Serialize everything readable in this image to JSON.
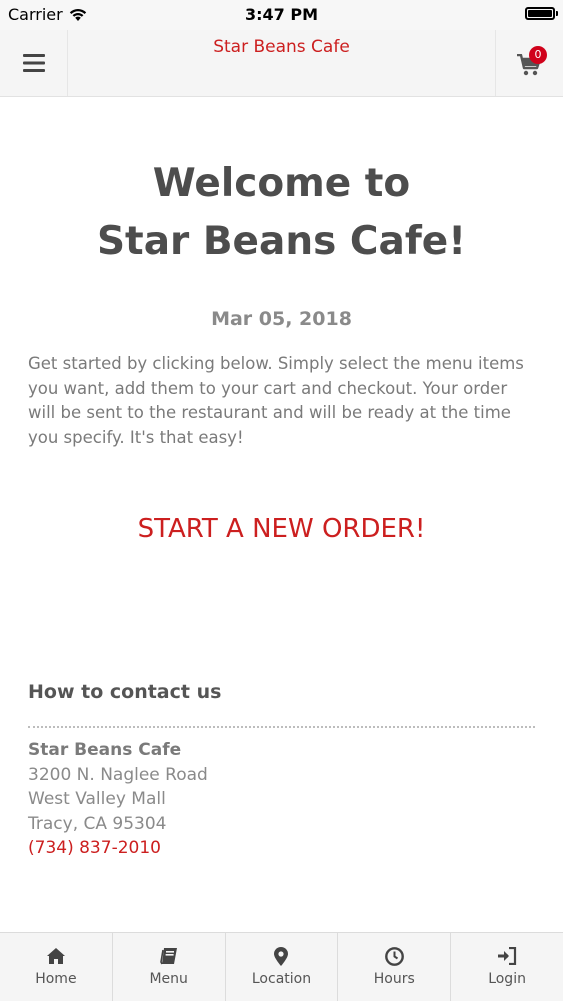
{
  "status_bar": {
    "carrier": "Carrier",
    "time": "3:47 PM"
  },
  "header": {
    "title": "Star Beans Cafe",
    "cart_count": "0"
  },
  "welcome": {
    "line1": "Welcome to",
    "line2": "Star Beans Cafe!"
  },
  "date": "Mar 05, 2018",
  "intro_text": "Get started by clicking below. Simply select the menu items you want, add them to your cart and checkout. Your order will be sent to the restaurant and will be ready at the time you specify. It's that easy!",
  "start_order_label": "START A NEW ORDER!",
  "contact": {
    "heading": "How to contact us",
    "name": "Star Beans Cafe",
    "address1": "3200 N. Naglee Road",
    "address2": "West Valley Mall",
    "city": "Tracy, CA 95304",
    "phone": "(734) 837-2010"
  },
  "tabs": [
    {
      "label": "Home",
      "icon": "home-icon"
    },
    {
      "label": "Menu",
      "icon": "book-icon"
    },
    {
      "label": "Location",
      "icon": "map-pin-icon"
    },
    {
      "label": "Hours",
      "icon": "clock-icon"
    },
    {
      "label": "Login",
      "icon": "login-icon"
    }
  ],
  "colors": {
    "accent": "#cc1f1f",
    "badge": "#d0021b",
    "text": "#555555"
  }
}
